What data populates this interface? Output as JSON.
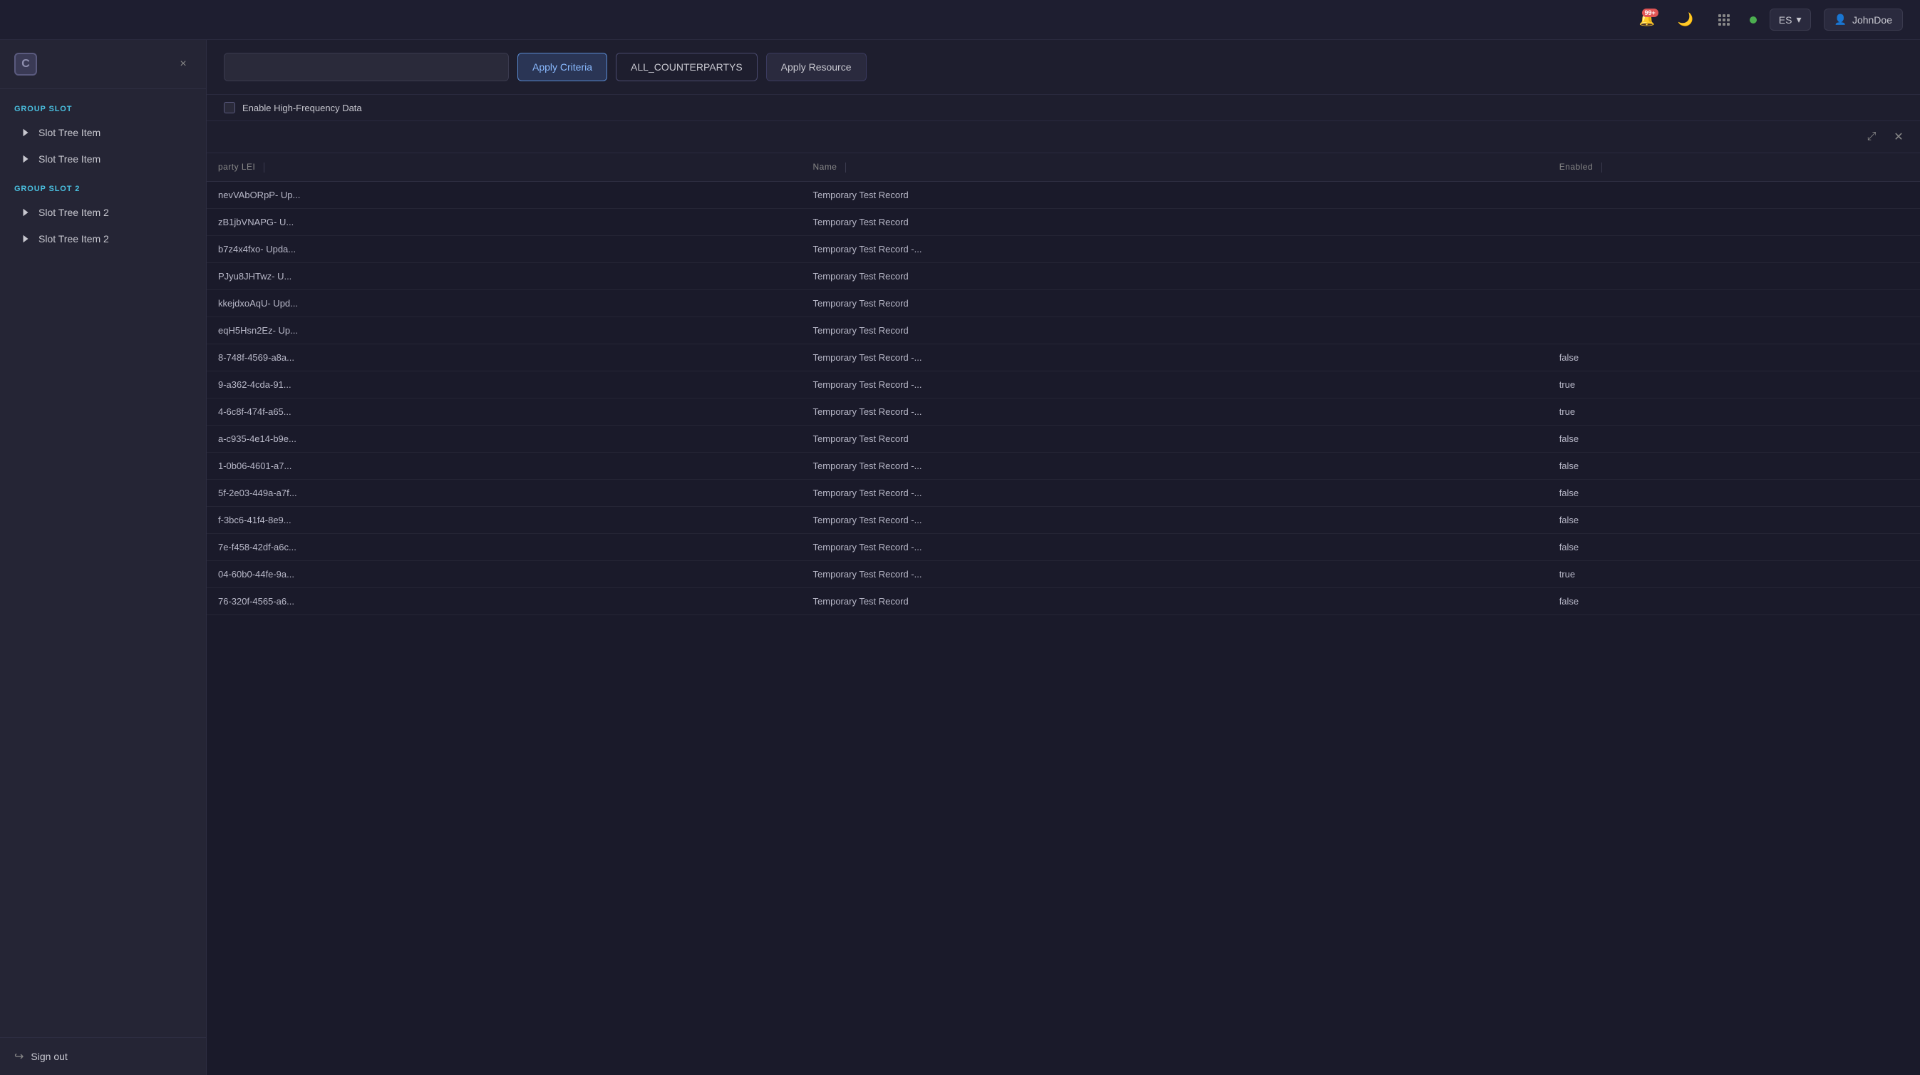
{
  "topbar": {
    "notif_count": "99+",
    "language": "ES",
    "user_name": "JohnDoe"
  },
  "sidebar": {
    "close_label": "×",
    "group1_label": "GROUP SLOT",
    "group2_label": "GROUP SLOT 2",
    "items_group1": [
      {
        "label": "Slot Tree Item"
      },
      {
        "label": "Slot Tree Item"
      }
    ],
    "items_group2": [
      {
        "label": "Slot Tree Item 2"
      },
      {
        "label": "Slot Tree Item 2"
      }
    ],
    "sign_out_label": "Sign out"
  },
  "toolbar": {
    "apply_criteria_label": "Apply Criteria",
    "all_counterpartys_label": "ALL_COUNTERPARTYS",
    "apply_resource_label": "Apply Resource",
    "enable_hf_label": "Enable High-Frequency Data"
  },
  "table": {
    "columns": [
      {
        "label": "party LEI"
      },
      {
        "label": "Name"
      },
      {
        "label": "Enabled"
      }
    ],
    "rows": [
      {
        "lei": "nevVAbORpP- Up...",
        "name": "Temporary Test Record",
        "enabled": ""
      },
      {
        "lei": "zB1jbVNAPG- U...",
        "name": "Temporary Test Record",
        "enabled": ""
      },
      {
        "lei": "b7z4x4fxo- Upda...",
        "name": "Temporary Test Record -...",
        "enabled": ""
      },
      {
        "lei": "PJyu8JHTwz- U...",
        "name": "Temporary Test Record",
        "enabled": ""
      },
      {
        "lei": "kkejdxoAqU- Upd...",
        "name": "Temporary Test Record",
        "enabled": ""
      },
      {
        "lei": "eqH5Hsn2Ez- Up...",
        "name": "Temporary Test Record",
        "enabled": ""
      },
      {
        "lei": "8-748f-4569-a8a...",
        "name": "Temporary Test Record -...",
        "enabled": "false"
      },
      {
        "lei": "9-a362-4cda-91...",
        "name": "Temporary Test Record -...",
        "enabled": "true"
      },
      {
        "lei": "4-6c8f-474f-a65...",
        "name": "Temporary Test Record -...",
        "enabled": "true"
      },
      {
        "lei": "a-c935-4e14-b9e...",
        "name": "Temporary Test Record",
        "enabled": "false"
      },
      {
        "lei": "1-0b06-4601-a7...",
        "name": "Temporary Test Record -...",
        "enabled": "false"
      },
      {
        "lei": "5f-2e03-449a-a7f...",
        "name": "Temporary Test Record -...",
        "enabled": "false"
      },
      {
        "lei": "f-3bc6-41f4-8e9...",
        "name": "Temporary Test Record -...",
        "enabled": "false"
      },
      {
        "lei": "7e-f458-42df-a6c...",
        "name": "Temporary Test Record -...",
        "enabled": "false"
      },
      {
        "lei": "04-60b0-44fe-9a...",
        "name": "Temporary Test Record -...",
        "enabled": "true"
      },
      {
        "lei": "76-320f-4565-a6...",
        "name": "Temporary Test Record",
        "enabled": "false"
      }
    ]
  }
}
